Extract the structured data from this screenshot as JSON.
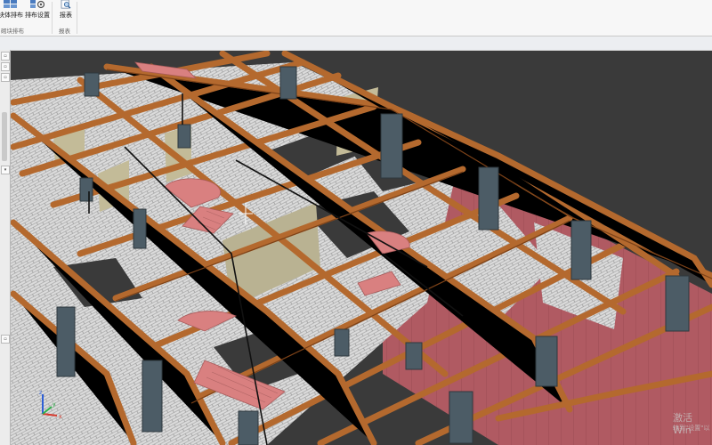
{
  "ribbon": {
    "buttons": [
      {
        "name": "block-layout-button",
        "label": "块体排布",
        "icon": "grid-blocks-icon"
      },
      {
        "name": "layout-settings-button",
        "label": "排布设置",
        "icon": "settings-blocks-icon"
      },
      {
        "name": "report-button",
        "label": "报表",
        "icon": "report-magnifier-icon"
      }
    ],
    "groups": [
      "砌块排布",
      "报表"
    ]
  },
  "viewport": {
    "axis": {
      "x": "x",
      "y": "y",
      "z": "z"
    }
  },
  "watermark": {
    "title": "激活 Win",
    "sub": "转到\"设置\"以"
  },
  "colors": {
    "beam": "#b4692e",
    "brick": "#d8d8d8",
    "floor": "#3a3a3a",
    "pink": "#b05a62",
    "column": "#4c5c66",
    "stair": "#d98080"
  }
}
